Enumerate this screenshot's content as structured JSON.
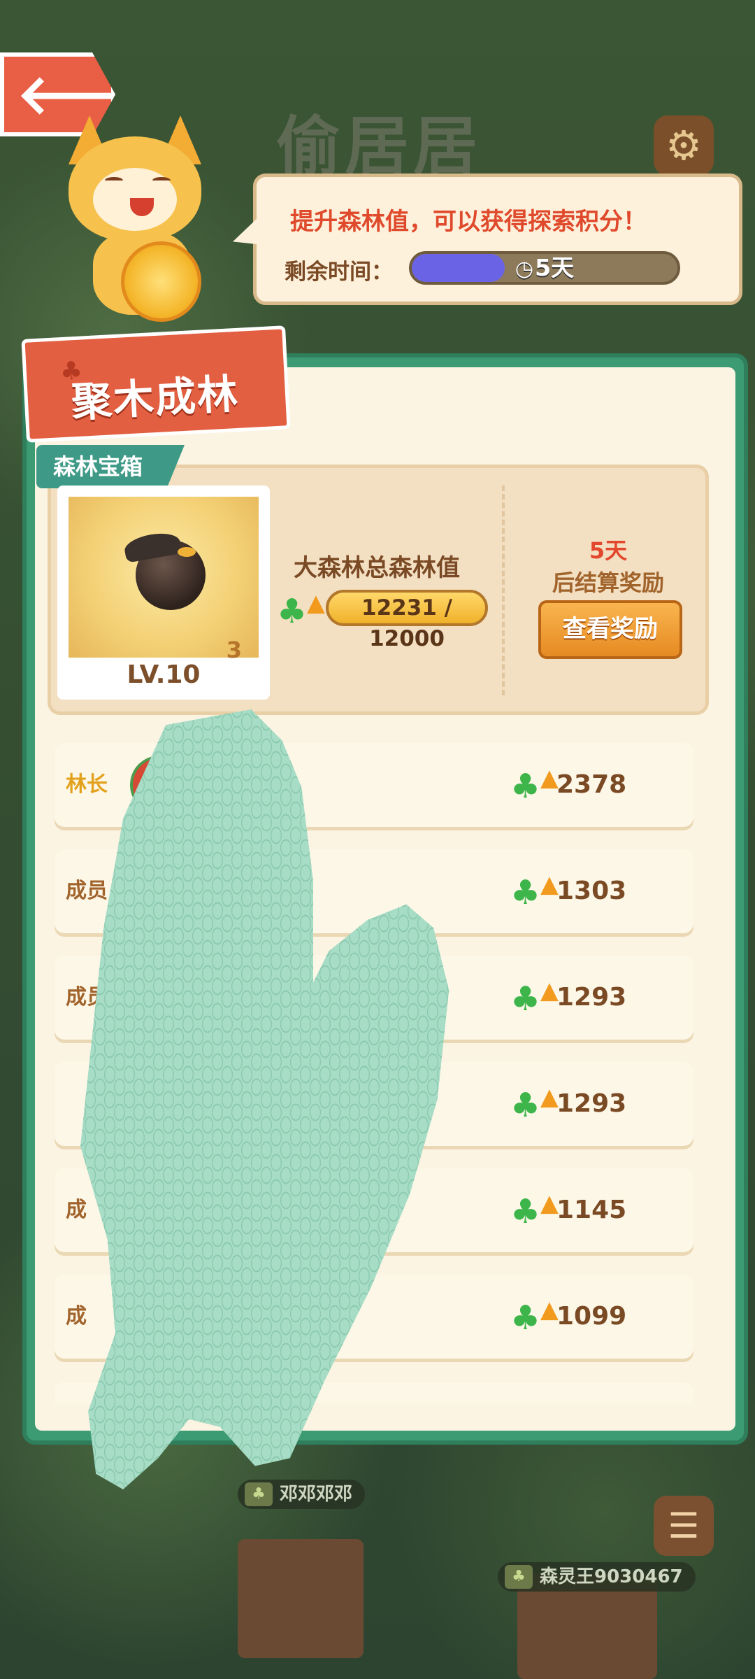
{
  "background": {
    "title": "偷居居",
    "labels": [
      {
        "name": "邓邓邓邓"
      },
      {
        "name": "森灵王9030467"
      }
    ]
  },
  "bubble": {
    "tip": "提升森林值，可以获得探索积分！",
    "time_label": "剩余时间：",
    "time_value": "5天",
    "time_progress": 0.35
  },
  "panel": {
    "title": "聚木成林",
    "chest_tag": "森林宝箱",
    "chest_count": "3",
    "chest_level": "LV.10",
    "total_label": "大森林总森林值",
    "total_value": "12231 / 12000",
    "settle_days": "5天",
    "settle_text": "后结算奖励",
    "view_reward": "查看奖励"
  },
  "members": [
    {
      "role": "林长",
      "score": "2378"
    },
    {
      "role": "成员",
      "score": "1303"
    },
    {
      "role": "成员",
      "score": "1293"
    },
    {
      "role": "",
      "score": "1293"
    },
    {
      "role": "成",
      "score": "1145"
    },
    {
      "role": "成",
      "score": "1099"
    }
  ],
  "colors": {
    "accent_red": "#e35f42",
    "panel_green": "#3d9b73",
    "score_brown": "#7a4a25",
    "clover_green": "#3db54a"
  }
}
